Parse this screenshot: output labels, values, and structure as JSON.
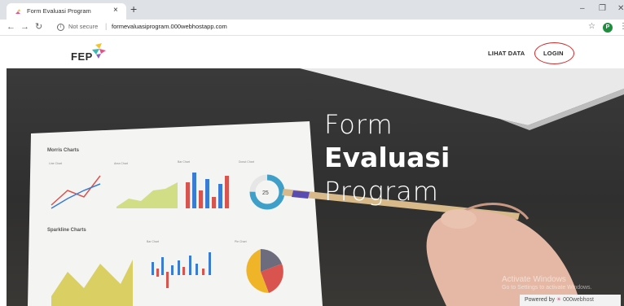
{
  "browser": {
    "tab_title": "Form Evaluasi Program",
    "tab_close": "×",
    "new_tab": "+",
    "not_secure": "Not secure",
    "url": "formevaluasiprogram.000webhostapp.com",
    "profile_initial": "P"
  },
  "header": {
    "logo_text": "FEP",
    "nav": {
      "lihat_data": "LIHAT DATA",
      "login": "LOGIN"
    }
  },
  "hero": {
    "title_line1": "Form",
    "title_line2": "Evaluasi",
    "title_line3": "Program",
    "image_texts": {
      "morris": "Morris Charts",
      "sparkline": "Sparkline Charts",
      "line": "Line Chart",
      "area": "Area Chart",
      "bar": "Bar Chart",
      "donut": "Donut Chart",
      "pie": "Pie Chart",
      "donut_value": "25"
    }
  },
  "overlay": {
    "activate_title": "Activate Windows",
    "activate_sub": "Go to Settings to activate Windows.",
    "powered_by": "Powered by",
    "powered_brand": "000webhost"
  },
  "colors": {
    "login_circle": "#d42a2a",
    "logo_yellow": "#f4c430",
    "logo_pink": "#e8508b",
    "logo_teal": "#3bb6b0",
    "logo_purple": "#8b5fbf"
  }
}
